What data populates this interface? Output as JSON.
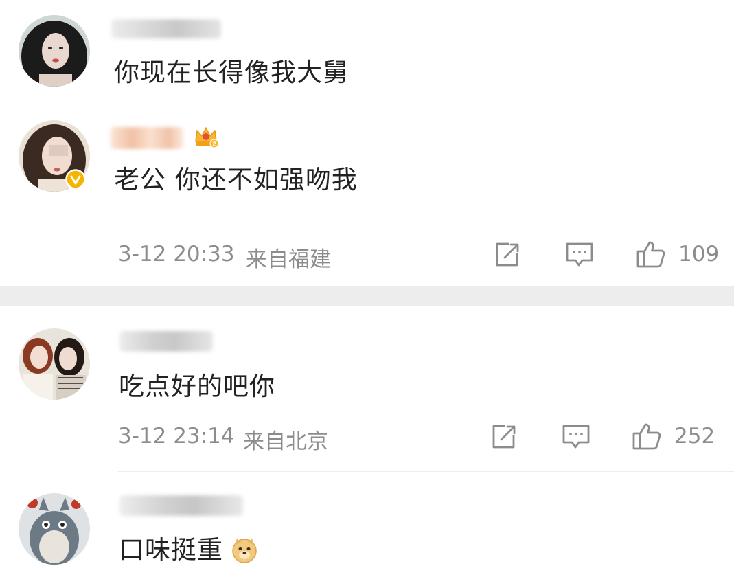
{
  "comments": [
    {
      "text": "你现在长得像我大舅"
    },
    {
      "text": "老公 你还不如强吻我",
      "verified": true,
      "crown_badge_text": "2",
      "timestamp": "3-12 20:33",
      "location": "来自福建",
      "likes": "109"
    },
    {
      "text": "吃点好的吧你",
      "timestamp": "3-12 23:14",
      "location": "来自北京",
      "likes": "252"
    },
    {
      "text": "口味挺重"
    }
  ],
  "colors": {
    "verified_badge": "#f5b400",
    "meta_gray": "#8c8c8c",
    "divider": "#ededed"
  }
}
